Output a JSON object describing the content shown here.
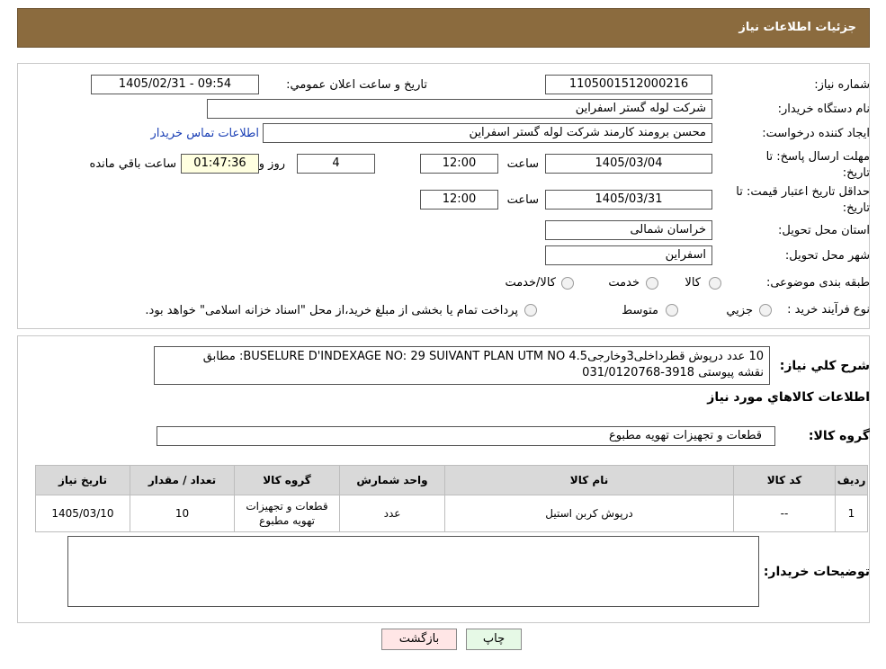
{
  "header": {
    "title": "جزئیات اطلاعات نیاز"
  },
  "form": {
    "need_number_label": "شماره نیاز:",
    "need_number": "1105001512000216",
    "announce_datetime_label": "تاریخ و ساعت اعلان عمومي:",
    "announce_datetime": "1405/02/31 - 09:54",
    "buyer_org_label": "نام دستگاه خریدار:",
    "buyer_org": "شرکت لوله گستر اسفراین",
    "requester_label": "ایجاد کننده درخواست:",
    "requester": "محسن برومند کارمند شرکت لوله گستر اسفراین",
    "contact_link": "اطلاعات تماس خریدار",
    "deadline_label": "مهلت ارسال پاسخ: تا تاریخ:",
    "deadline_date": "1405/03/04",
    "hour_label": "ساعت",
    "deadline_time": "12:00",
    "days": "4",
    "days_label": "روز و",
    "remaining_time": "01:47:36",
    "remaining_label": "ساعت باقي مانده",
    "validity_label": "حداقل تاریخ اعتبار قیمت: تا تاریخ:",
    "validity_date": "1405/03/31",
    "validity_time": "12:00",
    "province_label": "استان محل تحویل:",
    "province": "خراسان شمالی",
    "city_label": "شهر محل تحویل:",
    "city": "اسفراین",
    "category_label": "طبقه بندی موضوعی:",
    "category_options": [
      "کالا",
      "خدمت",
      "کالا/خدمت"
    ],
    "process_label": "نوع فرآیند خرید :",
    "process_options": [
      "جزيي",
      "متوسط"
    ],
    "process_note": "پرداخت تمام یا بخشی از مبلغ خرید،از محل \"اسناد خزانه اسلامی\" خواهد بود."
  },
  "details": {
    "summary_label": "شرح کلي نياز:",
    "summary_line1": "10 عدد درپوش قطرداخلی3وخارجی4.5 BUSELURE D'INDEXAGE NO: 29 SUIVANT PLAN UTM NO: مطابق",
    "summary_line2": "نقشه پیوستی 3918-031/0120768",
    "goods_info_title": "اطلاعات کالاهاي مورد نياز",
    "goods_group_label": "گروه کالا:",
    "goods_group": "قطعات و تجهیزات تهویه مطبوع",
    "table": {
      "headers": [
        "رديف",
        "کد کالا",
        "نام کالا",
        "واحد شمارش",
        "گروه کالا",
        "تعداد / مقدار",
        "تاريخ نياز"
      ],
      "rows": [
        [
          "1",
          "--",
          "درپوش کربن استیل",
          "عدد",
          "قطعات و تجهیزات تهویه مطبوع",
          "10",
          "1405/03/10"
        ]
      ]
    },
    "buyer_notes_label": "توضیحات خریدار:",
    "buyer_notes": ""
  },
  "buttons": {
    "print": "چاپ",
    "back": "بازگشت"
  },
  "colors": {
    "header_bg": "#8b6b3e",
    "table_header_bg": "#d9d9d9",
    "print_btn": "#e6f9e6",
    "back_btn": "#ffe6e6"
  }
}
